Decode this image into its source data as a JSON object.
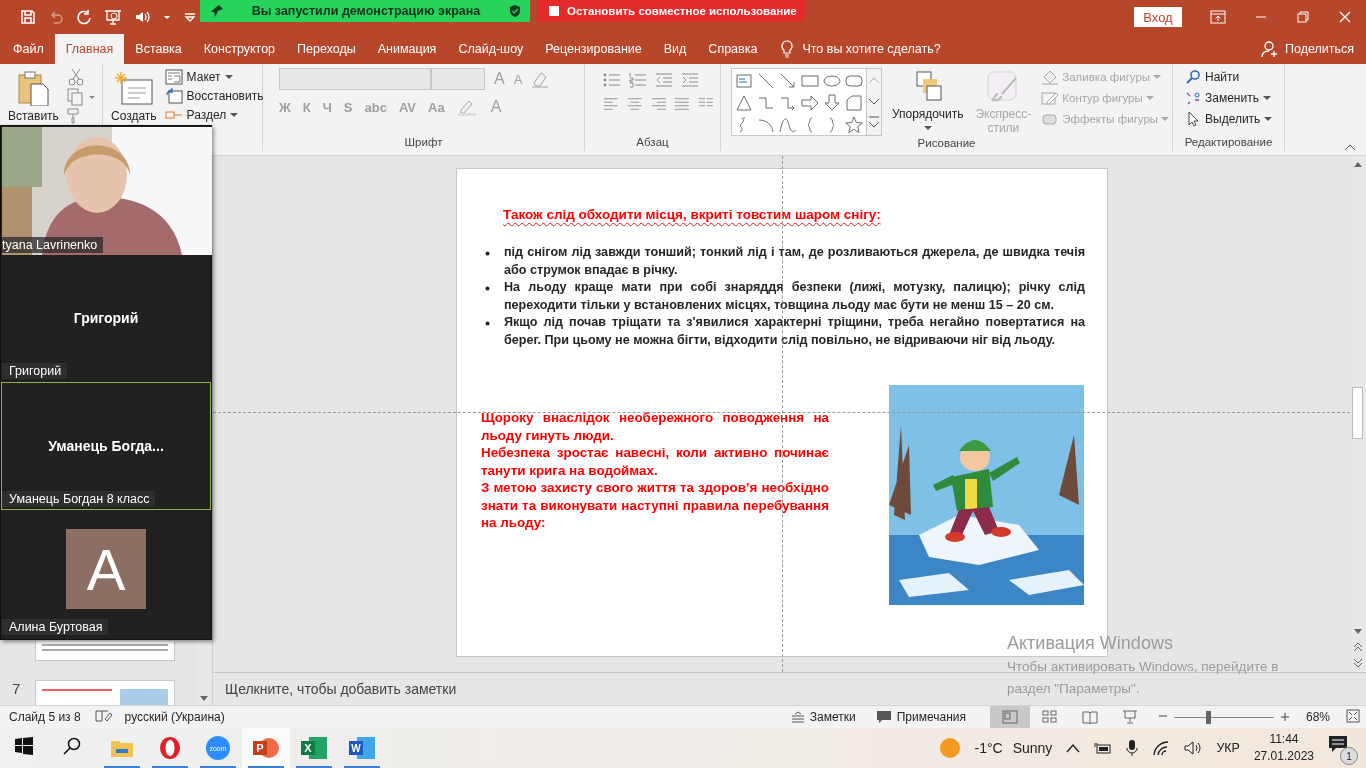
{
  "title_bar": {
    "share_status": "Вы запустили демонстрацию экрана",
    "stop_share": "Остановить совместное использование",
    "sign_in": "Вход"
  },
  "tabs": [
    {
      "label": "Файл",
      "selected": false
    },
    {
      "label": "Главная",
      "selected": true
    },
    {
      "label": "Вставка",
      "selected": false
    },
    {
      "label": "Конструктор",
      "selected": false
    },
    {
      "label": "Переходы",
      "selected": false
    },
    {
      "label": "Анимация",
      "selected": false
    },
    {
      "label": "Слайд-шоу",
      "selected": false
    },
    {
      "label": "Рецензирование",
      "selected": false
    },
    {
      "label": "Вид",
      "selected": false
    },
    {
      "label": "Справка",
      "selected": false
    }
  ],
  "tell_me": "Что вы хотите сделать?",
  "share": "Поделиться",
  "ribbon": {
    "clipboard": {
      "paste": "Вставить"
    },
    "slides": {
      "new_slide": "Создать",
      "layout": "Макет",
      "reset": "Восстановить",
      "section": "Раздел"
    },
    "font": {
      "label": "Шрифт",
      "disabled": true,
      "size_buttons": [
        "A",
        "A"
      ],
      "style_buttons": [
        "Ж",
        "К",
        "Ч",
        "S",
        "abc",
        "AV",
        "Aa"
      ],
      "color_button": "A"
    },
    "paragraph": {
      "label": "Абзац"
    },
    "drawing": {
      "label": "Рисование",
      "arrange": "Упорядочить",
      "quick_styles": {
        "label": "Экспресс-стили",
        "disabled": true
      },
      "commands": [
        {
          "kind": "fill",
          "label": "Заливка фигуры",
          "disabled": true
        },
        {
          "kind": "outline",
          "label": "Контур фигуры",
          "disabled": true
        },
        {
          "kind": "effects",
          "label": "Эффекты фигуры",
          "disabled": true
        }
      ]
    },
    "editing": {
      "label": "Редактирование",
      "commands": [
        {
          "kind": "find",
          "label": "Найти"
        },
        {
          "kind": "replace",
          "label": "Заменить"
        },
        {
          "kind": "select",
          "label": "Выделить"
        }
      ]
    }
  },
  "thumbnails": [
    {
      "kind": "text-slide"
    },
    {
      "kind": "picture-slide",
      "number": "7"
    }
  ],
  "meeting": {
    "tiles": [
      {
        "kind": "video",
        "name": "tyana Lavrinenko",
        "active": false
      },
      {
        "kind": "name",
        "title": "Григорий",
        "name": "Григорий",
        "active": false
      },
      {
        "kind": "name",
        "title": "Уманець  Богда...",
        "name": "Уманець Богдан 8 класс",
        "active": true
      },
      {
        "kind": "avatar",
        "initial": "A",
        "name": "Алина Буртовая",
        "active": false
      }
    ]
  },
  "slide": {
    "heading": "Також слід обходити місця, вкриті товстим шаром снігу:",
    "bullets": [
      "під снігом лід завжди тонший; тонкий лід і там, де розливаються джерела, де швидка течія або струмок впадає в річку.",
      "На льоду краще мати при собі знаряддя безпеки (лижі, мотузку, палицю); річку слід переходити тільки у встановлених місцях, товщина льоду має бути не менш 15 – 20 см.",
      "Якщо лід почав тріщати та з'явилися характерні тріщини, треба негайно повертатися на берег. При цьому не можна бігти, відходити слід повільно, не відриваючи ніг від льоду."
    ],
    "warning": [
      "Щороку  внаслідок необережного поводження на льоду гинуть люди.",
      "Небезпека зростає навесні, коли активно починає танути крига на водоймах.",
      "З метою захисту свого життя та здоров’я необхідно знати та виконувати наступні правила перебування на льоду:"
    ],
    "picture": {
      "kind": "picture"
    }
  },
  "notes_placeholder": "Щелкните, чтобы добавить заметки",
  "status_bar": {
    "slide": "Слайд 5 из 8",
    "language": "русский (Украина)",
    "notes": "Заметки",
    "comments": "Примечания",
    "views": [
      {
        "kind": "normal",
        "selected": true
      },
      {
        "kind": "sorter",
        "selected": false
      },
      {
        "kind": "reading",
        "selected": false
      },
      {
        "kind": "slideshow",
        "selected": false
      }
    ],
    "zoom": {
      "level": 0.34,
      "reading": "68%"
    }
  },
  "activation": {
    "title": "Активация Windows",
    "text": "Чтобы активировать Windows, перейдите в раздел \"Параметры\"."
  },
  "taskbar": {
    "apps": [
      {
        "kind": "explorer",
        "selected": false
      },
      {
        "kind": "opera",
        "selected": false
      },
      {
        "kind": "zoom",
        "glyph": "zoom",
        "selected": false
      },
      {
        "kind": "powerpoint",
        "glyph": "P",
        "selected": true
      },
      {
        "kind": "excel",
        "glyph": "X",
        "selected": false
      },
      {
        "kind": "word",
        "glyph": "W",
        "selected": false
      }
    ],
    "weather": {
      "temp": "-1°C",
      "condition": "Sunny"
    },
    "language": "УКР",
    "time": "11:44",
    "date": "27.01.2023",
    "notifications": "1"
  }
}
